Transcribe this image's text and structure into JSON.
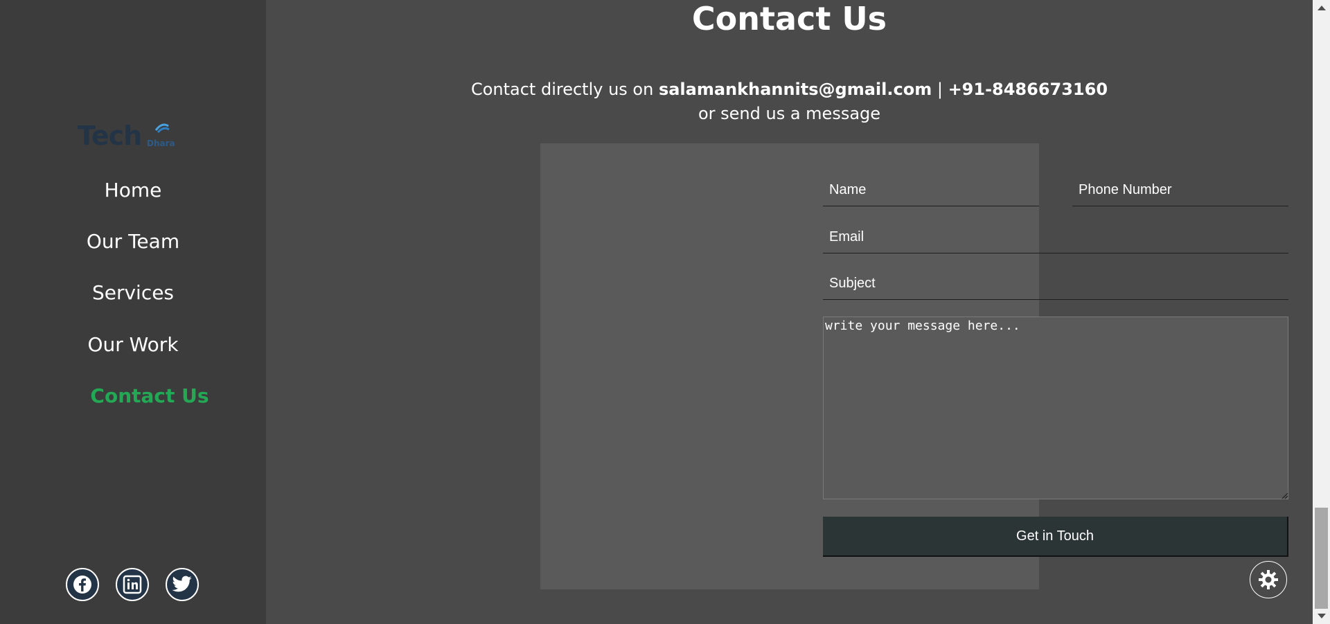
{
  "logo": {
    "text": "Tech",
    "subtext": "Dhara"
  },
  "nav": {
    "items": [
      {
        "label": "Home"
      },
      {
        "label": "Our Team"
      },
      {
        "label": "Services"
      },
      {
        "label": "Our Work"
      },
      {
        "label": "Contact Us",
        "active": true
      }
    ]
  },
  "socials": [
    {
      "icon": "facebook-icon"
    },
    {
      "icon": "linkedin-icon"
    },
    {
      "icon": "twitter-icon"
    }
  ],
  "main": {
    "title": "Contact Us",
    "contact_prefix": "Contact directly us on ",
    "email": "salamankhannits@gmail.com",
    "separator": " | ",
    "phone": "+91-8486673160",
    "contact_suffix": "or send us a message"
  },
  "form": {
    "name_placeholder": "Name",
    "phone_placeholder": "Phone Number",
    "email_placeholder": "Email",
    "subject_placeholder": "Subject",
    "message_placeholder": "write your message here...",
    "submit_label": "Get in Touch"
  },
  "colors": {
    "accent": "#23a955",
    "sidebar_bg": "#3c3c3c",
    "main_bg": "#4a4a4a",
    "card_bg": "#5a5a5a",
    "button_bg": "#2c3535"
  },
  "theme_toggle": {
    "icon": "sun-gear-icon"
  }
}
